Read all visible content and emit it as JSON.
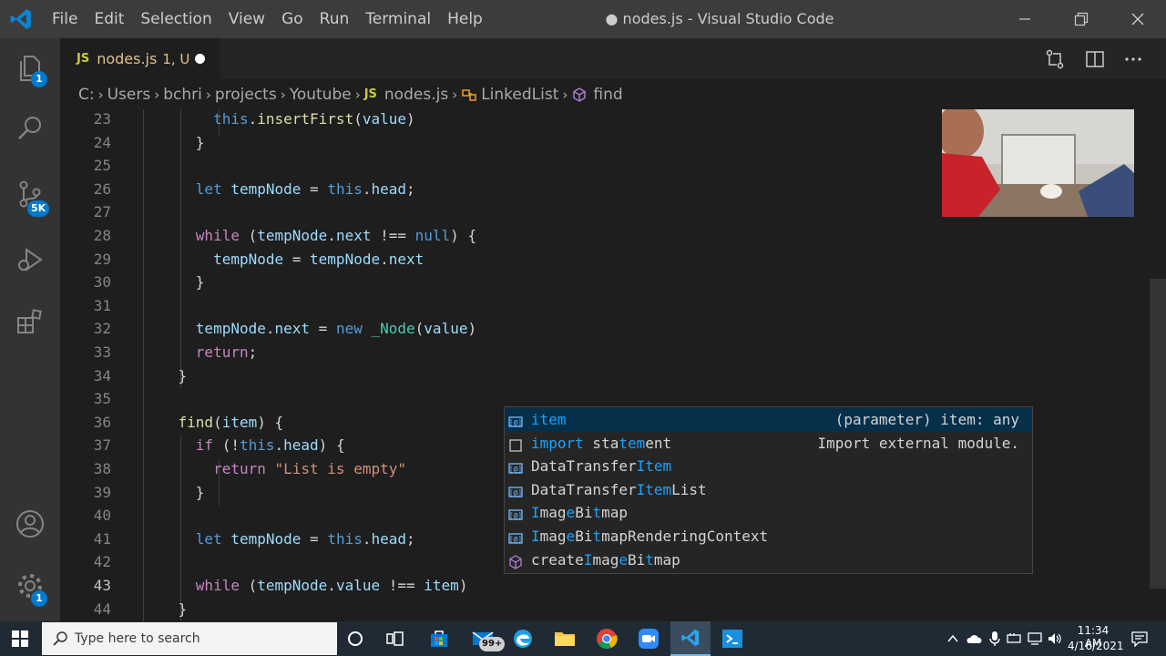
{
  "window": {
    "menu": [
      "File",
      "Edit",
      "Selection",
      "View",
      "Go",
      "Run",
      "Terminal",
      "Help"
    ],
    "title": "● nodes.js - Visual Studio Code"
  },
  "activity_bar": {
    "explorer_badge": "1",
    "source_control_badge": "5K",
    "settings_badge": "1"
  },
  "tab": {
    "icon_text": "JS",
    "filename": "nodes.js",
    "status": "1, U"
  },
  "breadcrumb": {
    "drive": "C:",
    "users": "Users",
    "user": "bchri",
    "projects": "projects",
    "folder": "Youtube",
    "file_icon": "JS",
    "file": "nodes.js",
    "class": "LinkedList",
    "method": "find"
  },
  "editor": {
    "current_line": "43",
    "lines": [
      {
        "n": "23",
        "t": [
          [
            "        ",
            "p"
          ],
          [
            "this",
            "kb"
          ],
          [
            ".",
            "p"
          ],
          [
            "insertFirst",
            "f"
          ],
          [
            "(",
            "p"
          ],
          [
            "value",
            "v"
          ],
          [
            ")",
            "p"
          ]
        ]
      },
      {
        "n": "24",
        "t": [
          [
            "      }",
            "p"
          ]
        ]
      },
      {
        "n": "25",
        "t": []
      },
      {
        "n": "26",
        "t": [
          [
            "      ",
            "p"
          ],
          [
            "let",
            "kb"
          ],
          [
            " ",
            "p"
          ],
          [
            "tempNode",
            "v"
          ],
          [
            " = ",
            "p"
          ],
          [
            "this",
            "kb"
          ],
          [
            ".",
            "p"
          ],
          [
            "head",
            "v"
          ],
          [
            ";",
            "p"
          ]
        ]
      },
      {
        "n": "27",
        "t": []
      },
      {
        "n": "28",
        "t": [
          [
            "      ",
            "p"
          ],
          [
            "while",
            "k"
          ],
          [
            " (",
            "p"
          ],
          [
            "tempNode",
            "v"
          ],
          [
            ".",
            "p"
          ],
          [
            "next",
            "v"
          ],
          [
            " !== ",
            "p"
          ],
          [
            "null",
            "kb"
          ],
          [
            ") {",
            "p"
          ]
        ]
      },
      {
        "n": "29",
        "t": [
          [
            "        ",
            "p"
          ],
          [
            "tempNode",
            "v"
          ],
          [
            " = ",
            "p"
          ],
          [
            "tempNode",
            "v"
          ],
          [
            ".",
            "p"
          ],
          [
            "next",
            "v"
          ]
        ]
      },
      {
        "n": "30",
        "t": [
          [
            "      }",
            "p"
          ]
        ]
      },
      {
        "n": "31",
        "t": []
      },
      {
        "n": "32",
        "t": [
          [
            "      ",
            "p"
          ],
          [
            "tempNode",
            "v"
          ],
          [
            ".",
            "p"
          ],
          [
            "next",
            "v"
          ],
          [
            " = ",
            "p"
          ],
          [
            "new",
            "kb"
          ],
          [
            " ",
            "p"
          ],
          [
            "_Node",
            "c"
          ],
          [
            "(",
            "p"
          ],
          [
            "value",
            "v"
          ],
          [
            ")",
            "p"
          ]
        ]
      },
      {
        "n": "33",
        "t": [
          [
            "      ",
            "p"
          ],
          [
            "return",
            "k"
          ],
          [
            ";",
            "p"
          ]
        ]
      },
      {
        "n": "34",
        "t": [
          [
            "    }",
            "p"
          ]
        ]
      },
      {
        "n": "35",
        "t": []
      },
      {
        "n": "36",
        "t": [
          [
            "    ",
            "p"
          ],
          [
            "find",
            "f"
          ],
          [
            "(",
            "p"
          ],
          [
            "item",
            "v"
          ],
          [
            ") {",
            "p"
          ]
        ]
      },
      {
        "n": "37",
        "t": [
          [
            "      ",
            "p"
          ],
          [
            "if",
            "k"
          ],
          [
            " (!",
            "p"
          ],
          [
            "this",
            "kb"
          ],
          [
            ".",
            "p"
          ],
          [
            "head",
            "v"
          ],
          [
            ") {",
            "p"
          ]
        ]
      },
      {
        "n": "38",
        "t": [
          [
            "        ",
            "p"
          ],
          [
            "return",
            "k"
          ],
          [
            " ",
            "p"
          ],
          [
            "\"List is empty\"",
            "s"
          ]
        ]
      },
      {
        "n": "39",
        "t": [
          [
            "      }",
            "p"
          ]
        ]
      },
      {
        "n": "40",
        "t": []
      },
      {
        "n": "41",
        "t": [
          [
            "      ",
            "p"
          ],
          [
            "let",
            "kb"
          ],
          [
            " ",
            "p"
          ],
          [
            "tempNode",
            "v"
          ],
          [
            " = ",
            "p"
          ],
          [
            "this",
            "kb"
          ],
          [
            ".",
            "p"
          ],
          [
            "head",
            "v"
          ],
          [
            ";",
            "p"
          ]
        ]
      },
      {
        "n": "42",
        "t": []
      },
      {
        "n": "43",
        "t": [
          [
            "      ",
            "p"
          ],
          [
            "while",
            "k"
          ],
          [
            " (",
            "p"
          ],
          [
            "tempNode",
            "v"
          ],
          [
            ".",
            "p"
          ],
          [
            "value",
            "v"
          ],
          [
            " !== ",
            "p"
          ],
          [
            "item",
            "v"
          ],
          [
            ")",
            "p"
          ]
        ]
      },
      {
        "n": "44",
        "t": [
          [
            "    }",
            "p"
          ]
        ]
      }
    ]
  },
  "suggestions": [
    {
      "icon": "variable-icon",
      "parts": [
        [
          "item",
          true
        ]
      ],
      "detail": "(parameter) item: any"
    },
    {
      "icon": "snippet-icon",
      "parts": [
        [
          "import",
          true
        ],
        [
          " sta",
          false
        ],
        [
          "tem",
          true
        ],
        [
          "ent",
          false
        ]
      ],
      "detail": "Import external module."
    },
    {
      "icon": "variable-icon",
      "parts": [
        [
          "DataTransfer",
          false
        ],
        [
          "Item",
          true
        ]
      ],
      "detail": ""
    },
    {
      "icon": "variable-icon",
      "parts": [
        [
          "DataTransfer",
          false
        ],
        [
          "Item",
          true
        ],
        [
          "List",
          false
        ]
      ],
      "detail": ""
    },
    {
      "icon": "variable-icon",
      "parts": [
        [
          "I",
          true
        ],
        [
          "mag",
          false
        ],
        [
          "e",
          true
        ],
        [
          "Bi",
          false
        ],
        [
          "t",
          true
        ],
        [
          "m",
          false
        ],
        [
          "ap",
          false
        ]
      ],
      "detail": ""
    },
    {
      "icon": "variable-icon",
      "parts": [
        [
          "I",
          true
        ],
        [
          "mag",
          false
        ],
        [
          "e",
          true
        ],
        [
          "Bi",
          false
        ],
        [
          "t",
          true
        ],
        [
          "m",
          false
        ],
        [
          "apRenderingContext",
          false
        ]
      ],
      "detail": ""
    },
    {
      "icon": "method-icon",
      "parts": [
        [
          "create",
          false
        ],
        [
          "I",
          true
        ],
        [
          "mag",
          false
        ],
        [
          "e",
          true
        ],
        [
          "Bi",
          false
        ],
        [
          "t",
          true
        ],
        [
          "m",
          false
        ],
        [
          "ap",
          false
        ]
      ],
      "detail": ""
    }
  ],
  "taskbar": {
    "search_placeholder": "Type here to search",
    "store_badge": "99+",
    "time": "11:34 AM",
    "date": "4/16/2021"
  }
}
